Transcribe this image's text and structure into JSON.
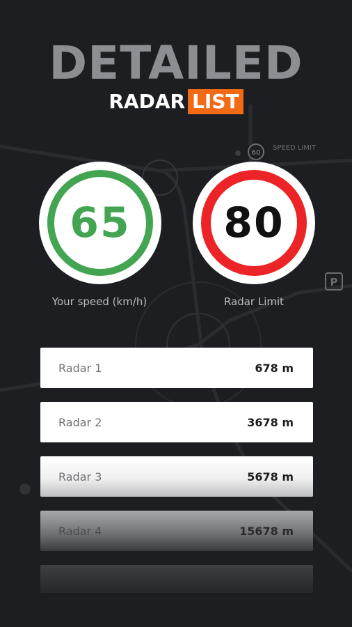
{
  "header": {
    "title": "DETAILED",
    "subtitle_part1": "RADAR",
    "subtitle_part2": "LIST"
  },
  "map": {
    "speed_limit_text": "SPEED LIMIT",
    "speed_limit_value": "60",
    "parking_label": "P"
  },
  "gauges": {
    "speed": {
      "value": "65",
      "label": "Your speed (km/h)",
      "color": "#43a451"
    },
    "limit": {
      "value": "80",
      "label": "Radar Limit",
      "color": "#ec2327"
    }
  },
  "radars": [
    {
      "name": "Radar 1",
      "distance": "678 m"
    },
    {
      "name": "Radar 2",
      "distance": "3678 m"
    },
    {
      "name": "Radar 3",
      "distance": "5678 m"
    },
    {
      "name": "Radar 4",
      "distance": "15678 m"
    }
  ],
  "colors": {
    "accent": "#f36a14",
    "background": "#1c1e21"
  }
}
